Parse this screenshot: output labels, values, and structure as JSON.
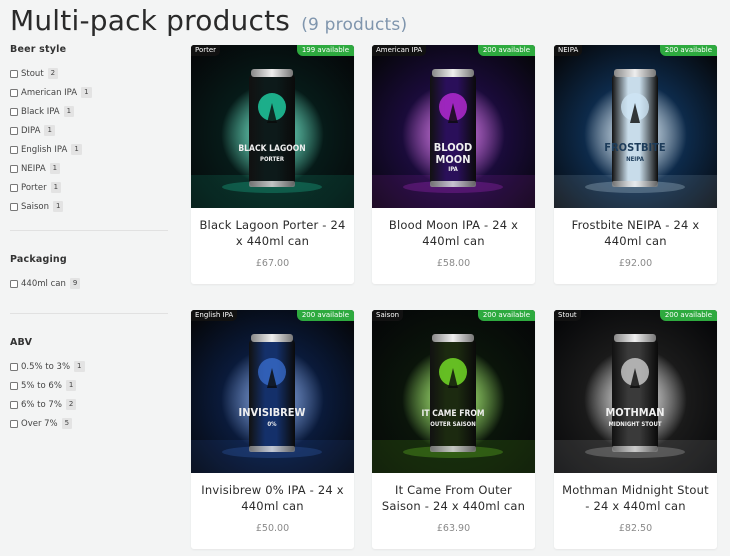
{
  "page": {
    "title": "Multi-pack products",
    "count": "(9 products)"
  },
  "filters": [
    {
      "heading": "Beer style",
      "options": [
        {
          "label": "Stout",
          "count": "2"
        },
        {
          "label": "American IPA",
          "count": "1"
        },
        {
          "label": "Black IPA",
          "count": "1"
        },
        {
          "label": "DIPA",
          "count": "1"
        },
        {
          "label": "English IPA",
          "count": "1"
        },
        {
          "label": "NEIPA",
          "count": "1"
        },
        {
          "label": "Porter",
          "count": "1"
        },
        {
          "label": "Saison",
          "count": "1"
        }
      ]
    },
    {
      "heading": "Packaging",
      "options": [
        {
          "label": "440ml can",
          "count": "9"
        }
      ]
    },
    {
      "heading": "ABV",
      "options": [
        {
          "label": "0.5% to 3%",
          "count": "1"
        },
        {
          "label": "5% to 6%",
          "count": "1"
        },
        {
          "label": "6% to 7%",
          "count": "2"
        },
        {
          "label": "Over 7%",
          "count": "5"
        }
      ]
    }
  ],
  "products": [
    {
      "style": "Porter",
      "availability": "199 available",
      "title": "Black Lagoon Porter - 24 x 440ml can",
      "price": "£67.00",
      "can_text": [
        "BLACK LAGOON",
        "PORTER"
      ],
      "colors": {
        "bg": "#061a18",
        "glow": "#22e0b0",
        "can": "#0d1a1a"
      }
    },
    {
      "style": "American IPA",
      "availability": "200 available",
      "title": "Blood Moon IPA - 24 x 440ml can",
      "price": "£58.00",
      "can_text": [
        "BLOOD",
        "MOON",
        "IPA"
      ],
      "colors": {
        "bg": "#1a0b3a",
        "glow": "#c42ee0",
        "can": "#2a0f5a"
      }
    },
    {
      "style": "NEIPA",
      "availability": "200 available",
      "title": "Frostbite NEIPA - 24 x 440ml can",
      "price": "£92.00",
      "can_text": [
        "FROSTBITE",
        "NEIPA"
      ],
      "colors": {
        "bg": "#0d2a4a",
        "glow": "#cfe6f5",
        "can": "#c8dcea"
      }
    },
    {
      "style": "English IPA",
      "availability": "200 available",
      "title": "Invisibrew 0% IPA - 24 x 440ml can",
      "price": "£50.00",
      "can_text": [
        "INVISIBREW",
        "0%"
      ],
      "colors": {
        "bg": "#0a1a3a",
        "glow": "#3a6fd0",
        "can": "#14306a"
      }
    },
    {
      "style": "Saison",
      "availability": "200 available",
      "title": "It Came From Outer Saison - 24 x 440ml can",
      "price": "£63.90",
      "can_text": [
        "IT CAME FROM",
        "OUTER SAISON"
      ],
      "colors": {
        "bg": "#0a140a",
        "glow": "#7ef02a",
        "can": "#1c2a10"
      }
    },
    {
      "style": "Stout",
      "availability": "200 available",
      "title": "Mothman Midnight Stout - 24 x 440ml can",
      "price": "£82.50",
      "can_text": [
        "MOTHMAN",
        "MIDNIGHT STOUT"
      ],
      "colors": {
        "bg": "#1a1a1a",
        "glow": "#d8d8d8",
        "can": "#3a3a3a"
      }
    }
  ]
}
